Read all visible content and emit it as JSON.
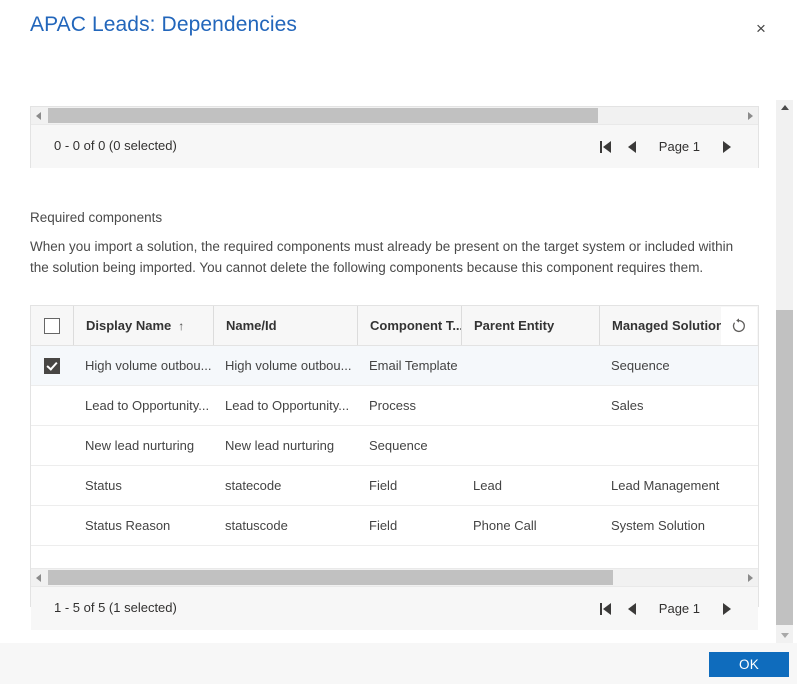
{
  "dialog": {
    "title": "APAC Leads: Dependencies",
    "close_label": "×"
  },
  "top_grid": {
    "pager": {
      "count_text": "0 - 0 of 0 (0 selected)",
      "page_label": "Page 1",
      "first_page_title": "First page",
      "previous_page_title": "Previous page",
      "next_page_title": "Next page"
    }
  },
  "required_components": {
    "heading": "Required components",
    "description": "When you import a solution, the required components must already be present on the target system or included within the solution being imported. You cannot delete the following components because this component requires them.",
    "refresh_label": "↻",
    "columns": [
      {
        "key": "select",
        "label": ""
      },
      {
        "key": "display_name",
        "label": "Display Name",
        "sort": "↑"
      },
      {
        "key": "name_id",
        "label": "Name/Id",
        "sort": ""
      },
      {
        "key": "component_type",
        "label": "Component T...",
        "sort": ""
      },
      {
        "key": "parent_entity",
        "label": "Parent Entity",
        "sort": ""
      },
      {
        "key": "managed_solution",
        "label": "Managed Solution",
        "sort": ""
      }
    ],
    "header_select_all_checked": false,
    "rows": [
      {
        "selected": true,
        "display_name": "High volume outbou...",
        "name_id": "High volume outbou...",
        "component_type": "Email Template",
        "parent_entity": "",
        "managed_solution": "Sequence"
      },
      {
        "selected": false,
        "display_name": "Lead to Opportunity...",
        "name_id": "Lead to Opportunity...",
        "component_type": "Process",
        "parent_entity": "",
        "managed_solution": "Sales"
      },
      {
        "selected": false,
        "display_name": "New lead nurturing",
        "name_id": "New lead nurturing",
        "component_type": "Sequence",
        "parent_entity": "",
        "managed_solution": ""
      },
      {
        "selected": false,
        "display_name": "Status",
        "name_id": "statecode",
        "component_type": "Field",
        "parent_entity": "Lead",
        "managed_solution": "Lead Management"
      },
      {
        "selected": false,
        "display_name": "Status Reason",
        "name_id": "statuscode",
        "component_type": "Field",
        "parent_entity": "Phone Call",
        "managed_solution": "System Solution"
      }
    ],
    "pager": {
      "count_text": "1 - 5 of 5 (1 selected)",
      "page_label": "Page 1",
      "first_page_title": "First page",
      "previous_page_title": "Previous page",
      "next_page_title": "Next page"
    }
  },
  "footer": {
    "ok_label": "OK"
  },
  "colors": {
    "title_blue": "#2266bb",
    "primary_button": "#0f6cbd",
    "checkbox_checked": "#484644",
    "scrollbar_thumb": "#c1c1c1",
    "pager_background": "#f7f7f7"
  }
}
